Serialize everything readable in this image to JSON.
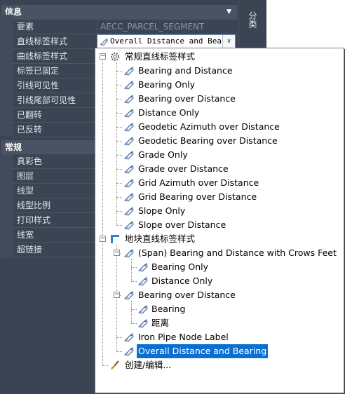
{
  "palette": {
    "info_header": "信息",
    "info_rows": [
      {
        "name": "要素",
        "value": "AECC_PARCEL_SEGMENT"
      },
      {
        "name": "直线标签样式",
        "value": ""
      },
      {
        "name": "曲线标签样式",
        "value": ""
      },
      {
        "name": "标签已固定",
        "value": ""
      },
      {
        "name": "引线可见性",
        "value": ""
      },
      {
        "name": "引线尾部可见性",
        "value": ""
      },
      {
        "name": "已翻转",
        "value": ""
      },
      {
        "name": "已反转",
        "value": ""
      }
    ],
    "general_header": "常规",
    "general_rows": [
      {
        "name": "真彩色"
      },
      {
        "name": "图层"
      },
      {
        "name": "线型"
      },
      {
        "name": "线型比例"
      },
      {
        "name": "打印样式"
      },
      {
        "name": "线宽"
      },
      {
        "name": "超链接"
      }
    ],
    "right_tab": "分类"
  },
  "style_field": {
    "value": "Overall Distance and Beari"
  },
  "tree": {
    "group1": {
      "label": "常规直线标签样式",
      "items": [
        "Bearing and Distance",
        "Bearing Only",
        "Bearing over Distance",
        "Distance Only",
        "Geodetic Azimuth over Distance",
        "Geodetic Bearing over Distance",
        "Grade Only",
        "Grade over Distance",
        "Grid Azimuth over Distance",
        "Grid Bearing over Distance",
        "Slope Only",
        "Slope over Distance"
      ]
    },
    "group2": {
      "label": "地块直线标签样式",
      "span": {
        "label": "(Span)  Bearing and Distance with Crows Feet",
        "children": [
          "Bearing Only",
          "Distance Only"
        ]
      },
      "bod": {
        "label": "Bearing over Distance",
        "children": [
          "Bearing",
          "距离"
        ]
      },
      "iron": "Iron Pipe Node Label",
      "selected": "Overall Distance and Bearing"
    },
    "create_edit": "创建/编辑..."
  }
}
